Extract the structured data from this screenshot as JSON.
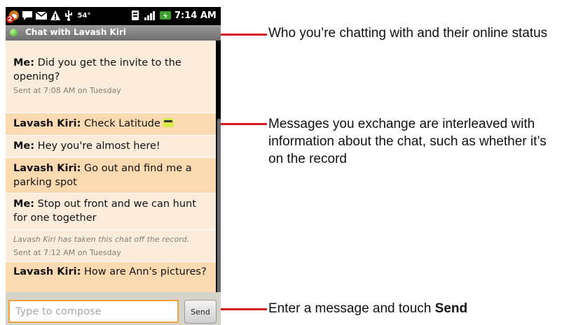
{
  "status_bar": {
    "notification_badge": "2",
    "temperature": "54°",
    "time": "7:14 AM",
    "icons": [
      "talk-notification-icon",
      "chat-bubble-icon",
      "email-icon",
      "warning-icon",
      "usb-icon",
      "vibrate-icon",
      "signal-icon",
      "battery-charging-icon"
    ]
  },
  "chat_header": {
    "title": "Chat with Lavash Kiri",
    "presence_color": "#3daa1f"
  },
  "messages": [
    {
      "speaker": "Me:",
      "text": " Did you get the invite to the opening?",
      "meta": "Sent at 7:08 AM on Tuesday"
    },
    {
      "speaker": "Lavash Kiri:",
      "text": " Check Latitude",
      "emoticon": "cool-smiley-icon"
    },
    {
      "speaker": "Me:",
      "text": " Hey you're almost here!"
    },
    {
      "speaker": "Lavash Kiri:",
      "text": " Go out and find me a parking spot"
    },
    {
      "speaker": "Me:",
      "text": " Stop out front and we can hunt for one together"
    },
    {
      "notice": "Lavash Kiri has taken this chat off the record.",
      "meta": "Sent at 7:12 AM on Tuesday"
    },
    {
      "speaker": "Lavash Kiri:",
      "text": " How are Ann's pictures?"
    }
  ],
  "compose": {
    "placeholder": "Type to compose",
    "value": ""
  },
  "send_button": {
    "label": "Send"
  },
  "callouts": {
    "header": "Who you’re chatting with and their online status",
    "messages": "Messages you exchange are interleaved with information about the chat, such as whether it’s on the record",
    "compose_before": "Enter a message and touch ",
    "compose_bold": "Send"
  },
  "colors": {
    "callout_line": "#d71920",
    "my_message_bg": "#fbecdb",
    "their_message_bg": "#fbd9b1",
    "compose_border": "#f2a33c"
  }
}
